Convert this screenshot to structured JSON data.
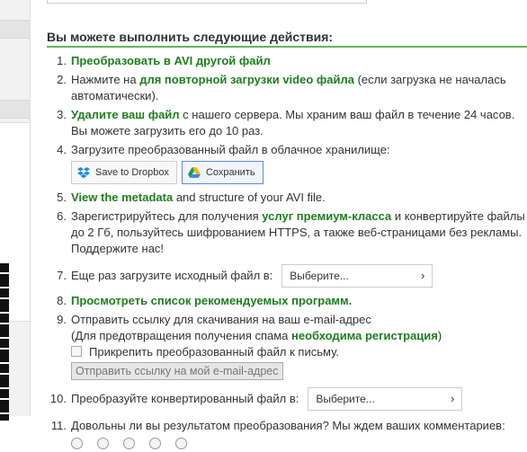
{
  "section_header": "Вы можете выполнить следующие действия:",
  "actions": {
    "n1": "1.",
    "n2": "2.",
    "n3": "3.",
    "n4": "4.",
    "n5": "5.",
    "n6": "6.",
    "n7": "7.",
    "n8": "8.",
    "n9": "9.",
    "n10": "10.",
    "n11": "11.",
    "item1_link": "Преобразовать в AVI другой файл",
    "item2_pre": "Нажмите на ",
    "item2_link": "для повторной загрузки video файла",
    "item2_post": " (если загрузка не началась автоматически).",
    "item3_link": "Удалите ваш файл",
    "item3_post": " с нашего сервера. Мы храним ваш файл в течение 24 часов. Вы можете загрузить его до 10 раз.",
    "item4_text": "Загрузите преобразованный файл в облачное хранилище:",
    "dropbox_label": "Save to Dropbox",
    "gdrive_label": "Сохранить",
    "item5_link": "View the metadata",
    "item5_post": " and structure of your AVI file.",
    "item6_pre": "Зарегистрируйтесь для получения ",
    "item6_link": "услуг премиум-класса",
    "item6_post": " и конвертируйте файлы до 2 Гб, пользуйтесь шифрованием HTTPS, а также веб-страницами без рекламы. Поддержите нас!",
    "item7_text": "Еще раз загрузите исходный файл в:",
    "item7_select": "Выберите...",
    "item8_link": "Просмотреть список рекомендуемых программ.",
    "item9_text": "Отправить ссылку для скачивания на ваш e-mail-адрес",
    "item9_note_pre": "(Для предотвращения получения спама ",
    "item9_note_link": "необходима регистрация",
    "item9_note_post": ")",
    "item9_checkbox_label": "Прикрепить преобразованный файл к письму.",
    "item9_send_button": "Отправить ссылку на мой e-mail-адрес",
    "item10_text": "Преобразуйте конвертированный файл в:",
    "item10_select": "Выберите...",
    "item11_text": "Довольны ли вы результатом преобразования? Мы ждем ваших комментариев:"
  },
  "colors": {
    "accent_green": "#1e7e1e",
    "header_rule": "#5cb85c",
    "gdrive_border": "#5b8bd0"
  },
  "icons": {
    "dropbox": "dropbox-icon",
    "gdrive": "google-drive-icon",
    "chevron": "chevron-right-icon"
  }
}
